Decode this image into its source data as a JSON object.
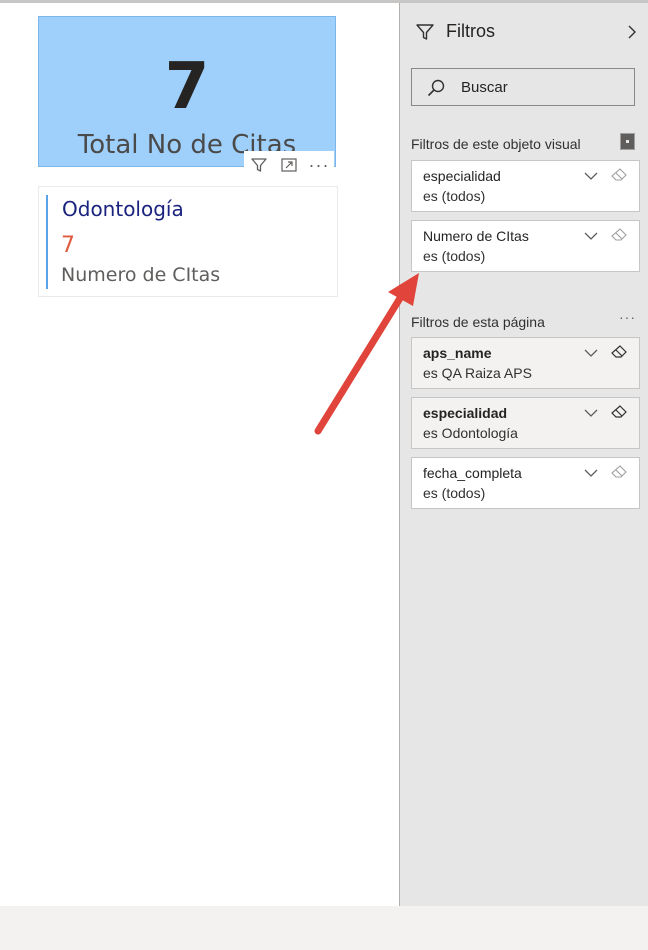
{
  "kpi": {
    "value": "7",
    "label": "Total No de Citas"
  },
  "visual_header": {
    "more_label": "···"
  },
  "multirow_card": {
    "title": "Odontología",
    "value": "7",
    "label": "Numero de CItas"
  },
  "filter_pane": {
    "title": "Filtros",
    "search_placeholder": "Buscar",
    "visual_section_title": "Filtros de este objeto visual",
    "visual_filters": [
      {
        "name": "especialidad",
        "value": "es (todos)"
      },
      {
        "name": "Numero de CItas",
        "value": "es (todos)"
      }
    ],
    "page_section_title": "Filtros de esta página",
    "page_more_label": "···",
    "page_filters": [
      {
        "name": "aps_name",
        "value": "es QA Raiza APS"
      },
      {
        "name": "especialidad",
        "value": "es Odontología"
      },
      {
        "name": "fecha_completa",
        "value": "es (todos)"
      }
    ]
  },
  "colors": {
    "kpi_background": "#9fd0fb",
    "card_title": "#1a237e",
    "card_value": "#e25a3d",
    "card_accent": "#5aa3e8",
    "annotation_arrow": "#e0443b",
    "pane_background": "#e6e6e6"
  }
}
